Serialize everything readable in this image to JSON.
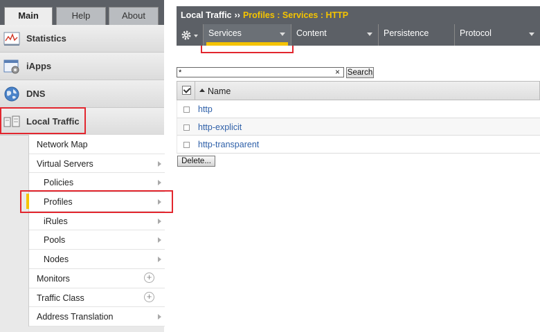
{
  "nav_tabs": [
    "Main",
    "Help",
    "About"
  ],
  "sidebar": {
    "sections": [
      {
        "label": "Statistics",
        "icon": "statistics-icon"
      },
      {
        "label": "iApps",
        "icon": "iapps-icon"
      },
      {
        "label": "DNS",
        "icon": "dns-globe-icon"
      },
      {
        "label": "Local Traffic",
        "icon": "local-traffic-icon"
      }
    ],
    "submenu": [
      {
        "label": "Network Map"
      },
      {
        "label": "Virtual Servers"
      },
      {
        "label": "Policies"
      },
      {
        "label": "Profiles",
        "selected": true
      },
      {
        "label": "iRules"
      },
      {
        "label": "Pools"
      },
      {
        "label": "Nodes"
      },
      {
        "label": "Monitors"
      },
      {
        "label": "Traffic Class"
      },
      {
        "label": "Address Translation"
      }
    ]
  },
  "breadcrumb": {
    "root": "Local Traffic",
    "separator": "››",
    "path": "Profiles : Services : HTTP"
  },
  "menu_tabs": [
    "Services",
    "Content",
    "Persistence",
    "Protocol"
  ],
  "search": {
    "value": "*",
    "clear": "×",
    "button": "Search"
  },
  "table": {
    "column": "Name",
    "rows": [
      "http",
      "http-explicit",
      "http-transparent"
    ]
  },
  "delete_button": "Delete...",
  "colors": {
    "accent_yellow": "#f5c400",
    "highlight_red": "#e2262e",
    "header_gray": "#5c6066",
    "link_blue": "#2d5fa8"
  }
}
